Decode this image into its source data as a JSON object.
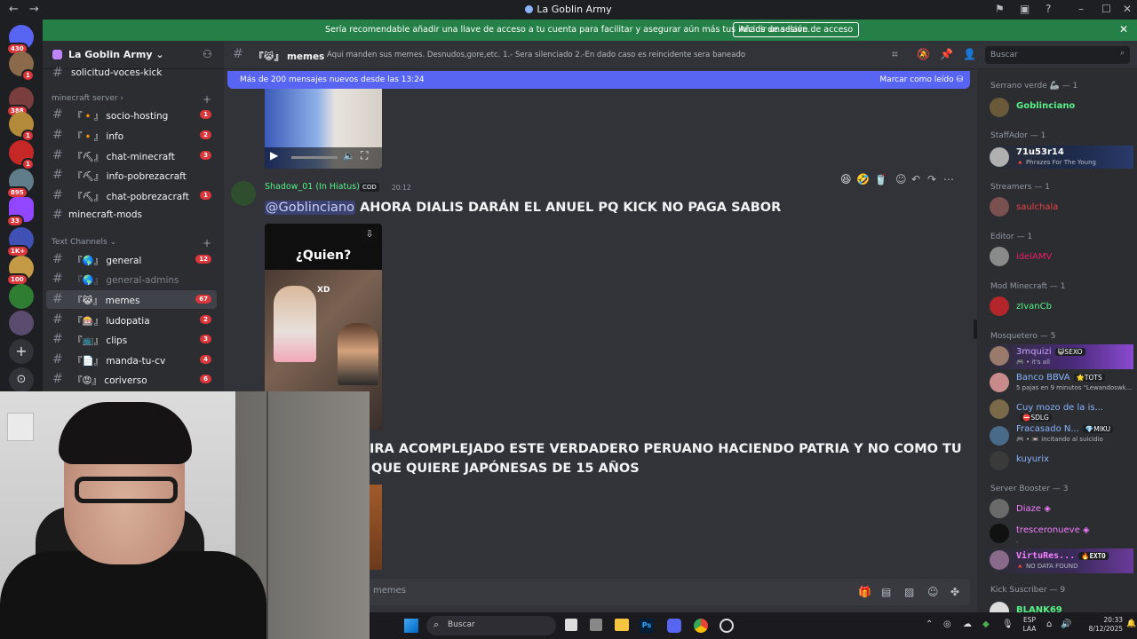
{
  "window": {
    "title": "La Goblin Army",
    "back_glyph": "←",
    "forward_glyph": "→",
    "minimize_glyph": "–",
    "maximize_glyph": "☐",
    "close_glyph": "✕"
  },
  "banner": {
    "text": "Sería recomendable añadir una llave de acceso a tu cuenta para facilitar y asegurar aún más tus inicios de sesión.",
    "button": "Añadir una llave de acceso"
  },
  "servers": [
    {
      "badge": "430"
    },
    {
      "badge": "1"
    },
    {
      "badge": "388"
    },
    {
      "badge": "1"
    },
    {
      "badge": "1"
    },
    {
      "badge": "895"
    },
    {
      "badge": "33"
    },
    {
      "badge": "1K+"
    },
    {
      "badge": "100"
    },
    {
      "badge": ""
    },
    {
      "badge": ""
    }
  ],
  "guild": {
    "name": "La Goblin Army"
  },
  "channels": {
    "top_partial": "solicitud-voces-kick",
    "cat1": "minecraft server",
    "cat2": "Text Channels",
    "list": [
      {
        "name": "socio-hosting",
        "prefix": "『🔸』",
        "count": "1"
      },
      {
        "name": "info",
        "prefix": "『🔸』",
        "count": "2"
      },
      {
        "name": "chat-minecraft",
        "prefix": "『⛏』",
        "count": "3"
      },
      {
        "name": "info-pobrezacraft",
        "prefix": "『⛏』",
        "count": ""
      },
      {
        "name": "chat-pobrezacraft",
        "prefix": "『⛏』",
        "count": "1"
      },
      {
        "name": "minecraft-mods",
        "prefix": "",
        "count": ""
      },
      {
        "name": "general",
        "prefix": "『🌎』",
        "count": "12"
      },
      {
        "name": "general-admins",
        "prefix": "『🌎』",
        "count": ""
      },
      {
        "name": "memes",
        "prefix": "『😹』",
        "count": "67"
      },
      {
        "name": "ludopatia",
        "prefix": "『🎰』",
        "count": "2"
      },
      {
        "name": "clips",
        "prefix": "『📺』",
        "count": "3"
      },
      {
        "name": "manda-tu-cv",
        "prefix": "『📄』",
        "count": "4"
      },
      {
        "name": "coriverso",
        "prefix": "『😡』",
        "count": "6"
      }
    ]
  },
  "header": {
    "channel": "memes",
    "channel_prefix": "『😹』",
    "topic": "Aqui manden sus memes. Desnudos,gore,etc. 1.- Sera silenciado 2.-En dado caso es reincidente sera baneado",
    "search_placeholder": "Buscar"
  },
  "newbar": {
    "left": "Más de 200 mensajes nuevos desde las 13:24",
    "right": "Marcar como leído"
  },
  "messages": {
    "author": "Shadow_01 (In Hiatus)",
    "author_tag": "COD",
    "time": "20:12",
    "mention": "@Goblinciano",
    "text1": "AHORA DIALIS DARÁN EL ANUEL PQ KICK NO PAGA SABOR",
    "image_title": "¿Quien?",
    "image_caption": "XD",
    "text2a": "IRA ACOMPLEJADO ESTE VERDADERO PERUANO HACIENDO PATRIA Y NO COMO TU",
    "text2b": "QUE QUIERE JAPÓNESAS DE 15 AÑOS",
    "composer_placeholder": "memes"
  },
  "members": {
    "roles": [
      {
        "label": "Serrano verde 🦾 — 1"
      },
      {
        "label": "StaffAdor — 1"
      },
      {
        "label": "Streamers — 1"
      },
      {
        "label": "Editor — 1"
      },
      {
        "label": "Mod Minecraft — 1"
      },
      {
        "label": "Mosquetero — 5"
      },
      {
        "label": "Server Booster — 3"
      },
      {
        "label": "Kick Suscriber — 9"
      }
    ],
    "people": [
      {
        "name": "Goblinciano",
        "color": "#57f287",
        "sub": ""
      },
      {
        "name": "71u53r14",
        "color": "#ffffff",
        "sub": "🔺 Phrazes For The Young"
      },
      {
        "name": "saulchala",
        "color": "#ed4245",
        "sub": ""
      },
      {
        "name": "idelAMV",
        "color": "#e91e63",
        "sub": ""
      },
      {
        "name": "zIvanCb",
        "color": "#57f287",
        "sub": ""
      },
      {
        "name": "3mquizi",
        "color": "#c7a6ff",
        "sub": "🎮 • it's all",
        "tag": "😺SEXO"
      },
      {
        "name": "Banco BBVA",
        "color": "#8ab4ff",
        "sub": "5 pajas en 9 minutos \"Lewandoswk...",
        "tag": "🌟TOTS"
      },
      {
        "name": "Cuy mozo de la is...",
        "color": "#8ab4ff",
        "sub": "",
        "tag": "⛔SDLG"
      },
      {
        "name": "Fracasado N...",
        "color": "#8ab4ff",
        "sub": "🎮 • 📼 incitando al suicidio",
        "tag": "💎MIKU"
      },
      {
        "name": "kuyurix",
        "color": "#8ab4ff",
        "sub": ""
      },
      {
        "name": "Diaze",
        "color": "#f47fff",
        "sub": ""
      },
      {
        "name": "tresceronueve",
        "color": "#f47fff",
        "sub": "."
      },
      {
        "name": "VirtuRes...",
        "color": "#f47fff",
        "sub": "🔺 NO DATA FOUND",
        "tag": "🔥EXTO"
      },
      {
        "name": "BLANK69",
        "color": "#57f287",
        "sub": ""
      }
    ]
  },
  "taskbar": {
    "search": "Buscar",
    "lang1": "ESP",
    "lang2": "LAA",
    "time": "20:33",
    "date": "8/12/2025"
  }
}
